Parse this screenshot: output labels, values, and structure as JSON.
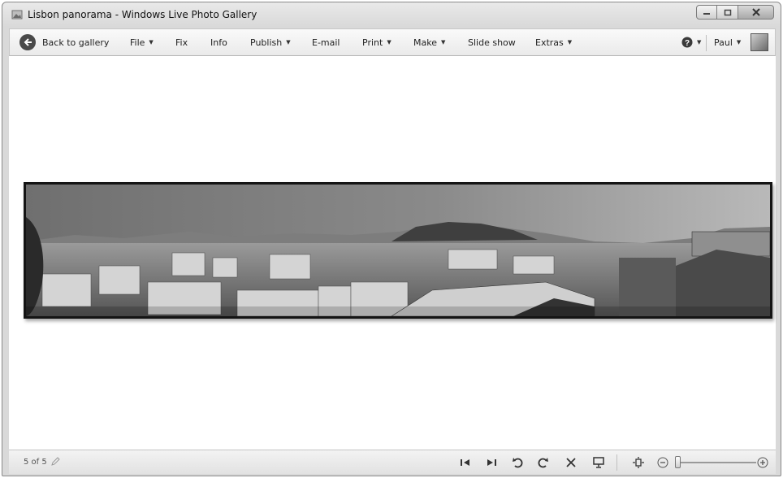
{
  "window": {
    "title": "Lisbon panorama - Windows Live Photo Gallery"
  },
  "menu": {
    "back": "Back to gallery",
    "file": "File",
    "fix": "Fix",
    "info": "Info",
    "publish": "Publish",
    "email": "E-mail",
    "print": "Print",
    "make": "Make",
    "slideshow": "Slide show",
    "extras": "Extras",
    "user": "Paul"
  },
  "status": {
    "counter": "5 of 5"
  },
  "zoom": {
    "level": 0.0
  },
  "icons": {
    "app": "photo-gallery-icon",
    "back": "back-arrow-icon",
    "help": "help-icon",
    "previous": "previous-icon",
    "next": "next-icon",
    "rotate_left": "rotate-counterclockwise-icon",
    "rotate_right": "rotate-clockwise-icon",
    "delete": "delete-icon",
    "slideshow": "slideshow-icon",
    "actual_size": "actual-size-icon",
    "zoom_out": "zoom-out-icon",
    "zoom_in": "zoom-in-icon"
  },
  "colors": {
    "frame": "#d9d9d9",
    "photo_border": "#141414"
  }
}
